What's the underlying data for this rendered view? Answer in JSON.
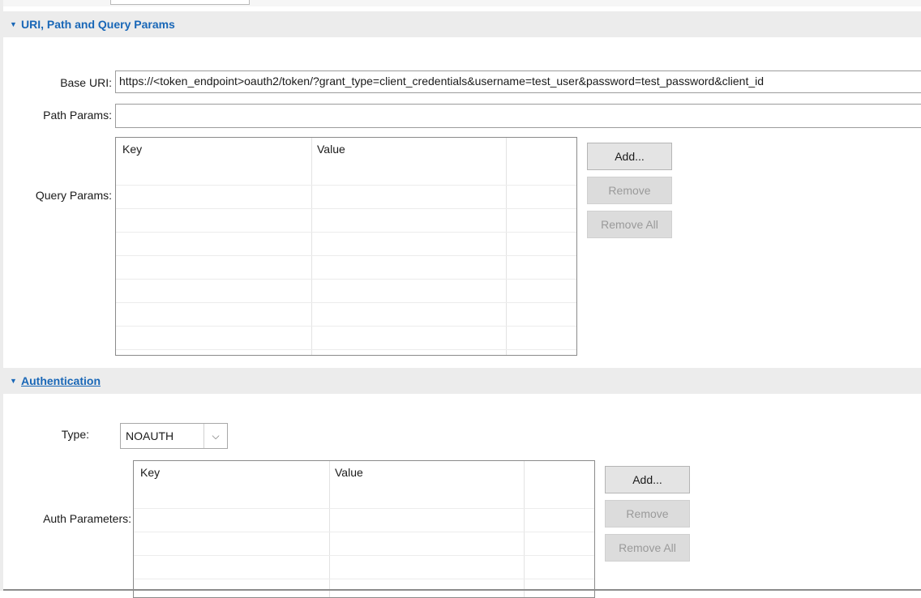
{
  "uri_section": {
    "title": "URI, Path and Query Params",
    "base_uri_label": "Base URI:",
    "base_uri_value": "https://<token_endpoint>oauth2/token/?grant_type=client_credentials&username=test_user&password=test_password&client_id",
    "path_params_label": "Path Params:",
    "path_params_value": "",
    "query_params_label": "Query Params:",
    "query_table": {
      "columns": [
        "Key",
        "Value",
        ""
      ]
    },
    "buttons": {
      "add": "Add...",
      "remove": "Remove",
      "remove_all": "Remove All"
    }
  },
  "auth_section": {
    "title": "Authentication",
    "type_label": "Type:",
    "type_value": "NOAUTH",
    "auth_params_label": "Auth Parameters:",
    "auth_table": {
      "columns": [
        "Key",
        "Value",
        ""
      ]
    },
    "buttons": {
      "add": "Add...",
      "remove": "Remove",
      "remove_all": "Remove All"
    }
  },
  "icons": {
    "section_toggle": "chevron-down-icon",
    "dropdown": "chevron-down-icon"
  }
}
